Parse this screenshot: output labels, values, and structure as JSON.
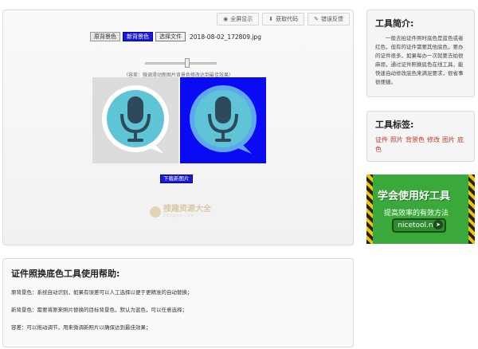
{
  "toolbar": {
    "fullscreen_label": "全屏显示",
    "get_code_label": "获取代码",
    "report_label": "错误反馈"
  },
  "controls": {
    "original_bg_label": "原背景色",
    "new_bg_label": "新背景色",
    "choose_file_label": "选择文件",
    "filename": "2018-08-02_172809.jpg",
    "hint": "（容差：微调滑动新图片背景色修改达到最佳效果）"
  },
  "slider": {
    "value": 0.55
  },
  "download_label": "下载新图片",
  "watermark": {
    "text": "搜趣资源大全",
    "sub": "ZHUOJIU.COM"
  },
  "help": {
    "title": "证件照换底色工具使用帮助:",
    "lines": [
      "原背景色：系统自动识别，如果有误差可以人工选择以便于更精准的自动替换；",
      "新背景色：需要将原来照片替换的目标背景色，默认为蓝色，可以任意选择；",
      "容差：可以拖动调节，用来微调新照片以确保达到最佳效果；"
    ]
  },
  "intro": {
    "title": "工具简介:",
    "text": "一般去拍证件照时底色是蓝色或者红色，但有的证件需要其他底色，要办的证件很多，如果每办一次就要去拍很麻烦，通过证件照换底色在线工具，能快速自动修改底色来满足要求，很省事很便捷。"
  },
  "tags": {
    "title": "工具标签:",
    "items": [
      "证件",
      "照片",
      "背景色",
      "修改",
      "图片",
      "底色"
    ]
  },
  "ad": {
    "title": "学会使用好工具",
    "subtitle": "提高效率的有效方法",
    "url": "nicetool.net"
  },
  "colors": {
    "new_bg": "#0a0af5",
    "original_bg": "#dcdcdc",
    "tag_color": "#c0392b",
    "ad_green": "#3aa83a"
  }
}
